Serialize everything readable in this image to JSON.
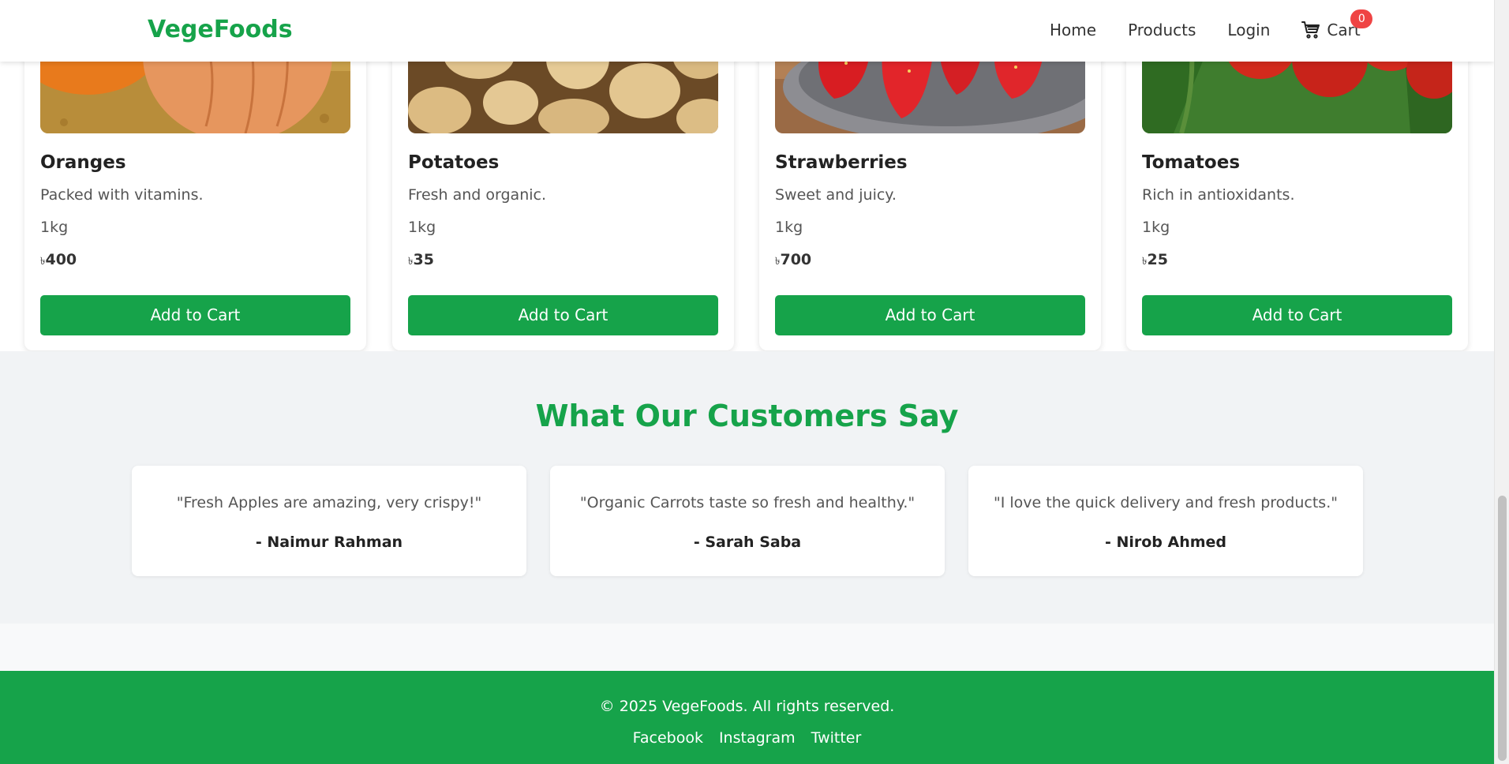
{
  "brand": "VegeFoods",
  "nav": {
    "home": "Home",
    "products": "Products",
    "login": "Login",
    "cart": "Cart",
    "cart_count": "0"
  },
  "products": [
    {
      "name": "Oranges",
      "desc": "Packed with vitamins.",
      "weight": "1kg",
      "currency": "৳",
      "price": "400",
      "button": "Add to Cart"
    },
    {
      "name": "Potatoes",
      "desc": "Fresh and organic.",
      "weight": "1kg",
      "currency": "৳",
      "price": "35",
      "button": "Add to Cart"
    },
    {
      "name": "Strawberries",
      "desc": "Sweet and juicy.",
      "weight": "1kg",
      "currency": "৳",
      "price": "700",
      "button": "Add to Cart"
    },
    {
      "name": "Tomatoes",
      "desc": "Rich in antioxidants.",
      "weight": "1kg",
      "currency": "৳",
      "price": "25",
      "button": "Add to Cart"
    }
  ],
  "testimonials": {
    "title": "What Our Customers Say",
    "items": [
      {
        "quote": "\"Fresh Apples are amazing, very crispy!\"",
        "author": "- Naimur Rahman"
      },
      {
        "quote": "\"Organic Carrots taste so fresh and healthy.\"",
        "author": "- Sarah Saba"
      },
      {
        "quote": "\"I love the quick delivery and fresh products.\"",
        "author": "- Nirob Ahmed"
      }
    ]
  },
  "footer": {
    "copyright": "© 2025 VegeFoods. All rights reserved.",
    "links": [
      "Facebook",
      "Instagram",
      "Twitter"
    ]
  },
  "colors": {
    "brand_green": "#16a34a",
    "badge_red": "#ef4444",
    "section_bg": "#f1f3f5"
  }
}
